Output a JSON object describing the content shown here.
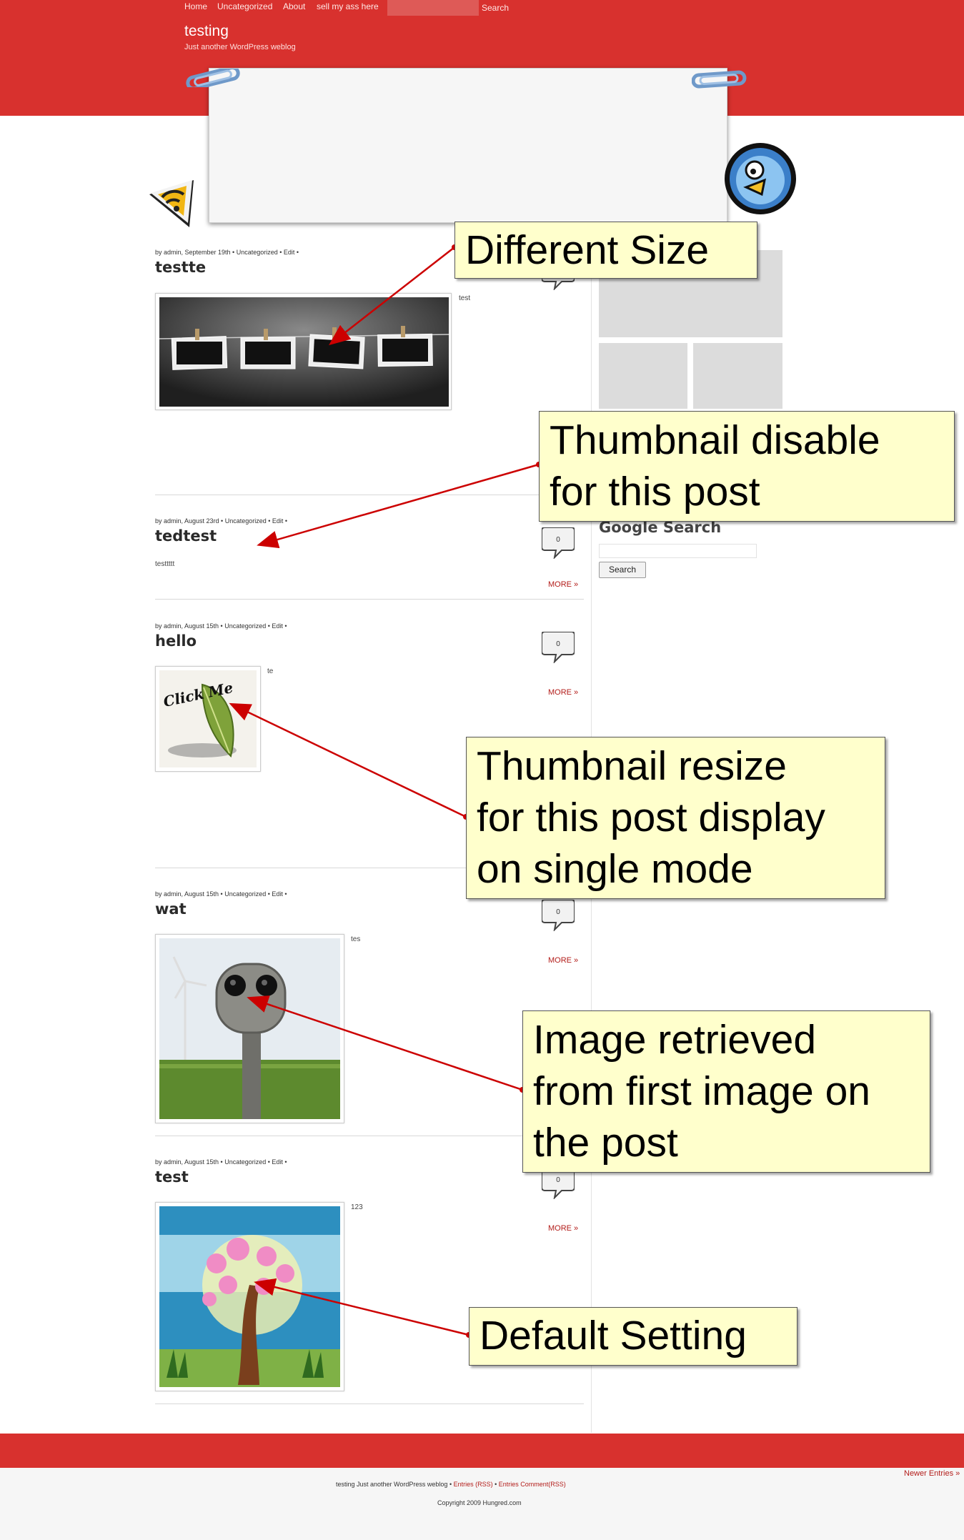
{
  "nav": {
    "items": [
      "Home",
      "Uncategorized",
      "About",
      "sell my ass here"
    ],
    "search_label": "Search"
  },
  "site": {
    "title": "testing",
    "tagline": "Just another WordPress weblog"
  },
  "posts": [
    {
      "meta": "by admin, September 19th • Uncategorized • Edit •",
      "title": "testte",
      "excerpt": "test",
      "thumbnail": "clothesline-polaroids"
    },
    {
      "meta": "by admin, August 23rd • Uncategorized • Edit •",
      "title": "tedtest",
      "excerpt": "testtttt",
      "comments": "0",
      "more": "MORE »"
    },
    {
      "meta": "by admin, August 15th • Uncategorized • Edit •",
      "title": "hello",
      "excerpt": "te",
      "comments": "0",
      "more": "MORE »",
      "thumbnail": "click-me-leaf",
      "thumb_caption": "Click Me"
    },
    {
      "meta": "by admin, August 15th • Uncategorized • Edit •",
      "title": "wat",
      "excerpt": "tes",
      "comments": "0",
      "more": "MORE »",
      "thumbnail": "binoculars"
    },
    {
      "meta": "by admin, August 15th • Uncategorized • Edit •",
      "title": "test",
      "excerpt": "123",
      "comments": "0",
      "more": "MORE »",
      "thumbnail": "blossom-tree"
    }
  ],
  "sidebar": {
    "google_title": "Google Search",
    "search_button": "Search"
  },
  "footer": {
    "newer_entries": "Newer Entries »",
    "line1_site": "testing Just another WordPress weblog",
    "entries_rss": "Entries (RSS)",
    "comments_rss": "Entries Comment(RSS)",
    "copyright": "Copyright 2009 Hungred.com"
  },
  "annotations": {
    "different_size": "Different Size",
    "thumb_disable_1": "Thumbnail disable",
    "thumb_disable_2": "for this post",
    "thumb_resize_1": "Thumbnail resize",
    "thumb_resize_2": "for this post display",
    "thumb_resize_3": "on single mode",
    "image_retrieved_1": "Image retrieved",
    "image_retrieved_2": "from first image on",
    "image_retrieved_3": "the post",
    "default_setting": "Default Setting"
  },
  "colors": {
    "brand_red": "#d8312e",
    "note_yellow": "#ffffcc",
    "arrow_red": "#cc0000"
  }
}
